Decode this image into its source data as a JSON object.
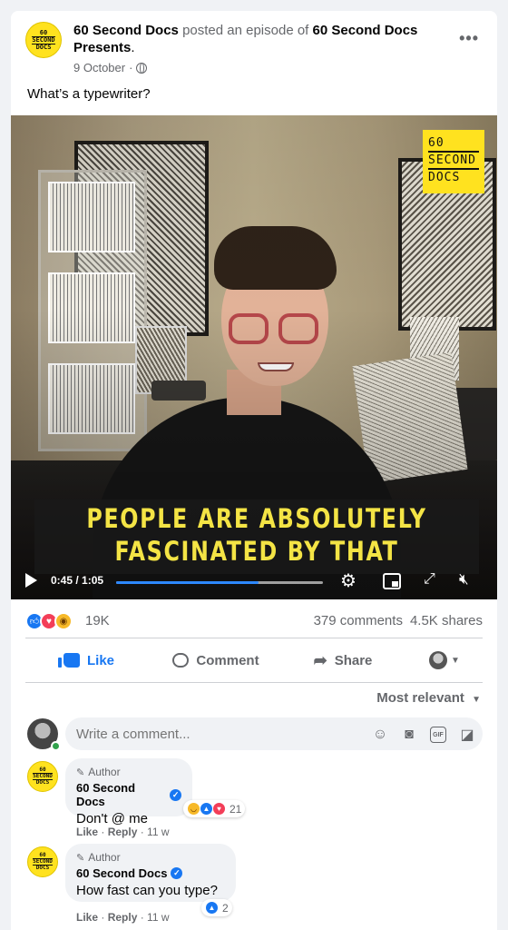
{
  "post": {
    "page_name": "60 Second Docs",
    "action_text": "posted an episode of",
    "show_name": "60 Second Docs Presents",
    "date": "9 October",
    "more": "•••",
    "text": "What’s a typewriter?",
    "logo_lines": [
      "60",
      "SECOND",
      "DOCS"
    ]
  },
  "video": {
    "brand_lines": [
      "60",
      "SECOND",
      "DOCS"
    ],
    "caption_line1": "PEOPLE ARE ABSOLUTELY",
    "caption_line2": "FASCINATED BY THAT",
    "time": "0:45 / 1:05",
    "progress": 0.69
  },
  "reactions": {
    "count": "19K",
    "comments": "379 comments",
    "shares": "4.5K shares",
    "types": [
      "like",
      "love",
      "wow"
    ]
  },
  "actions": {
    "like": "Like",
    "comment": "Comment",
    "share": "Share"
  },
  "sort": {
    "label": "Most relevant"
  },
  "composer": {
    "placeholder": "Write a comment..."
  },
  "comments": [
    {
      "tag": "Author",
      "name": "60 Second Docs",
      "text": "Don't @ me",
      "reaction_count": "21",
      "like": "Like",
      "reply": "Reply",
      "time": "11 w"
    },
    {
      "tag": "Author",
      "name": "60 Second Docs",
      "text": "How fast can you type?",
      "reaction_count": "2",
      "like": "Like",
      "reply": "Reply",
      "time": "11 w"
    }
  ],
  "colors": {
    "brand_yellow": "#ffe21f",
    "facebook_blue": "#1877f2",
    "caption_yellow": "#f4e445"
  }
}
